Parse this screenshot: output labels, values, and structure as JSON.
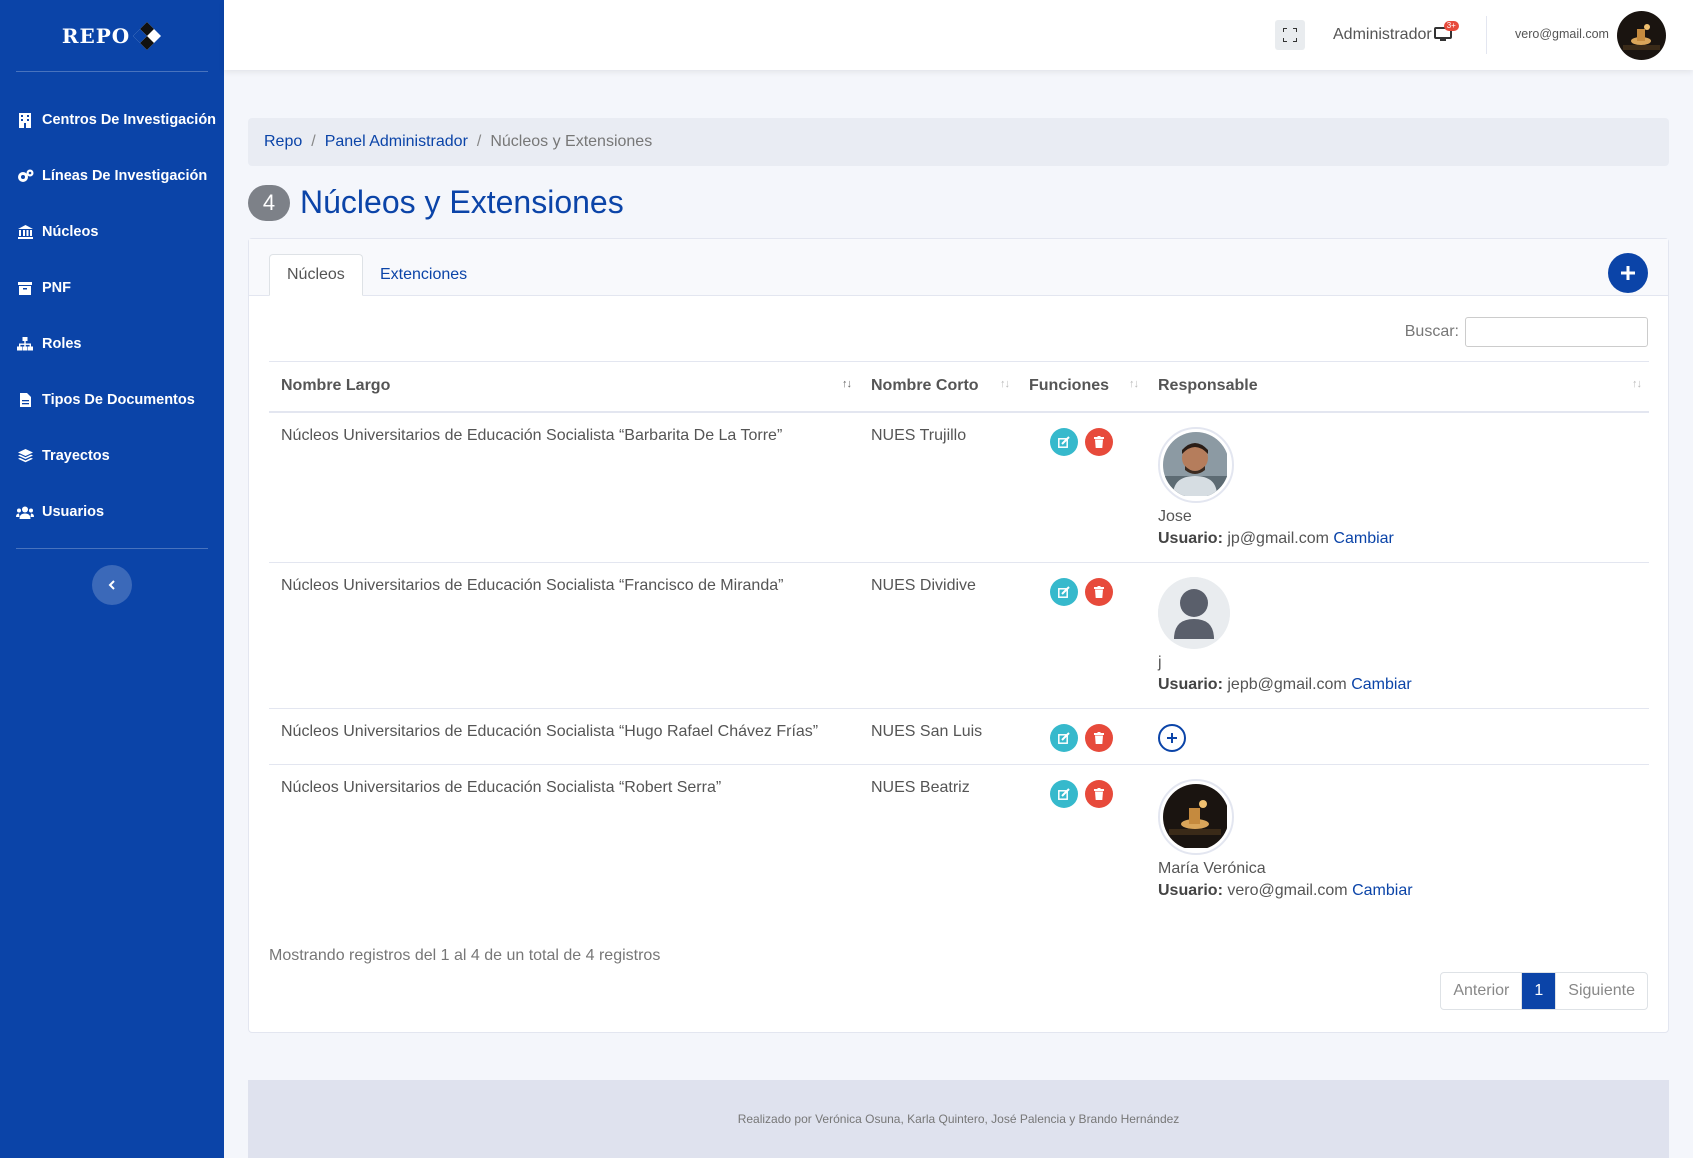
{
  "sidebar": {
    "brand": "REPO",
    "items": [
      {
        "label": "Centros De Investigación",
        "icon": "building-icon"
      },
      {
        "label": "Líneas De Investigación",
        "icon": "cogs-icon"
      },
      {
        "label": "Núcleos",
        "icon": "university-icon"
      },
      {
        "label": "PNF",
        "icon": "archive-icon"
      },
      {
        "label": "Roles",
        "icon": "sitemap-icon"
      },
      {
        "label": "Tipos De Documentos",
        "icon": "file-icon"
      },
      {
        "label": "Trayectos",
        "icon": "layers-icon"
      },
      {
        "label": "Usuarios",
        "icon": "users-icon"
      }
    ]
  },
  "topbar": {
    "role": "Administrador",
    "notif_badge": "3+",
    "email": "vero@gmail.com"
  },
  "breadcrumb": {
    "items": [
      "Repo",
      "Panel Administrador"
    ],
    "current": "Núcleos y Extensiones"
  },
  "page": {
    "count": "4",
    "title": "Núcleos y Extensiones"
  },
  "tabs": [
    "Núcleos",
    "Extenciones"
  ],
  "search": {
    "label": "Buscar:",
    "value": ""
  },
  "table": {
    "headers": [
      "Nombre Largo",
      "Nombre Corto",
      "Funciones",
      "Responsable"
    ],
    "rows": [
      {
        "largo": "Núcleos Universitarios de Educación Socialista “Barbarita De La Torre”",
        "corto": "NUES Trujillo",
        "responsable": {
          "name": "Jose",
          "user_label": "Usuario:",
          "email": "jp@gmail.com",
          "action": "Cambiar",
          "avatar": "photo-man"
        }
      },
      {
        "largo": "Núcleos Universitarios de Educación Socialista “Francisco de Miranda”",
        "corto": "NUES Dividive",
        "responsable": {
          "name": "j",
          "user_label": "Usuario:",
          "email": "jepb@gmail.com",
          "action": "Cambiar",
          "avatar": "default-user"
        }
      },
      {
        "largo": "Núcleos Universitarios de Educación Socialista “Hugo Rafael Chávez Frías”",
        "corto": "NUES San Luis",
        "responsable": null
      },
      {
        "largo": "Núcleos Universitarios de Educación Socialista “Robert Serra”",
        "corto": "NUES Beatriz",
        "responsable": {
          "name": "María Verónica",
          "user_label": "Usuario:",
          "email": "vero@gmail.com",
          "action": "Cambiar",
          "avatar": "photo-night"
        }
      }
    ]
  },
  "info": "Mostrando registros del 1 al 4 de un total de 4 registros",
  "pagination": {
    "prev": "Anterior",
    "page": "1",
    "next": "Siguiente"
  },
  "footer": "Realizado por Verónica Osuna, Karla Quintero, José Palencia y Brando Hernández",
  "colors": {
    "primary": "#0b44a8",
    "edit": "#36b9cc",
    "delete": "#e74a3b",
    "badge": "#7d8188"
  }
}
